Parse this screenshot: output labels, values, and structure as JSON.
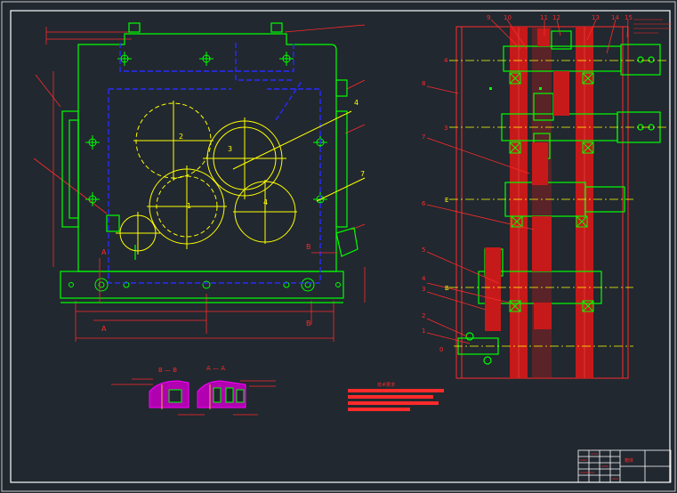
{
  "colors": {
    "background": "#212830",
    "frame": "#ffffff",
    "housing": "#00ff00",
    "hidden": "#2a2aff",
    "gear": "#ffff00",
    "dim": "#ff2a2a",
    "section": "#ff00ff",
    "cyan": "#00ffff",
    "gray": "#c8c8c8"
  },
  "front_view": {
    "gear_labels": [
      "2",
      "3",
      "1",
      "4"
    ],
    "leader_labels": [
      "4",
      "7"
    ],
    "section_marks": [
      "A",
      "A",
      "B",
      "B"
    ]
  },
  "side_view": {
    "left_callouts": [
      "4",
      "8",
      "3",
      "7",
      "6",
      "5",
      "4",
      "3",
      "2",
      "1",
      "0"
    ],
    "top_callouts": [
      "9",
      "10",
      "11",
      "12",
      "13",
      "14",
      "15"
    ],
    "shaft_labels": [
      "E",
      "B"
    ]
  },
  "section_views": {
    "left_title": "B — B",
    "right_title": "A — A"
  },
  "notes": {
    "heading": "技术要求"
  },
  "title_block": {
    "name_cell": "箱体"
  }
}
